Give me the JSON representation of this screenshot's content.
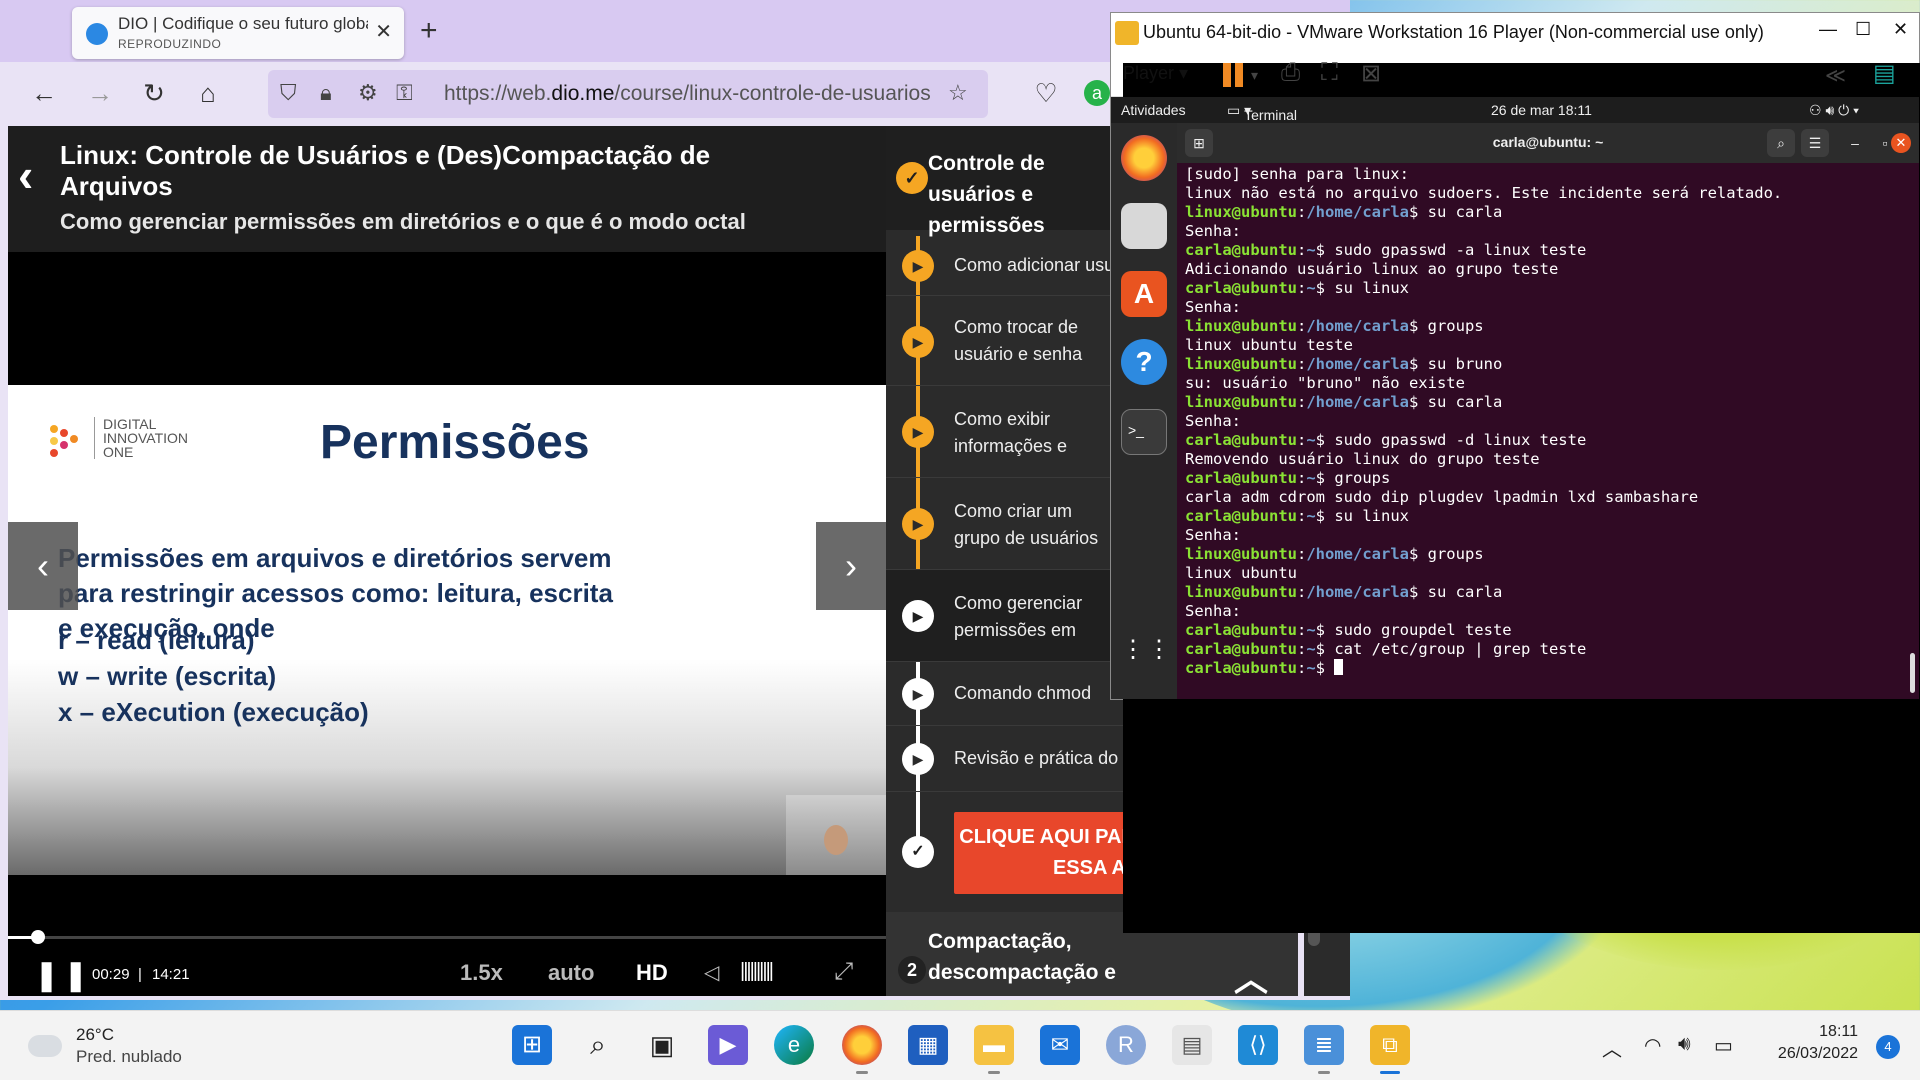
{
  "browser": {
    "tab_title": "DIO | Codifique o seu futuro global",
    "tab_status": "REPRODUZINDO",
    "url_prefix": "https://web.",
    "url_domain": "dio.me",
    "url_path": "/course/linux-controle-de-usuarios"
  },
  "course": {
    "title": "Linux: Controle de Usuários e (Des)Compactação de Arquivos",
    "subtitle": "Como gerenciar permissões em diretórios e o que é o modo octal"
  },
  "slide": {
    "logo_lines": [
      "DIGITAL",
      "INNOVATION",
      "ONE"
    ],
    "heading": "Permissões",
    "paragraph": "Permissões em arquivos e diretórios servem para restringir acessos como: leitura, escrita e execução, onde",
    "items": [
      "r – read (leitura)",
      "w – write (escrita)",
      "x – eXecution (execução)"
    ]
  },
  "player": {
    "current_time": "00:29",
    "separator": "|",
    "duration": "14:21",
    "speed": "1.5x",
    "quality_mode": "auto",
    "hd": "HD",
    "progress_fraction": 0.034
  },
  "lessons": {
    "section_title": "Controle de usuários e permissões",
    "items": [
      {
        "label": "Como adicionar usuários",
        "state": "current"
      },
      {
        "label": "Como trocar de usuário e senha",
        "state": "current"
      },
      {
        "label": "Como exibir informações e remover um usuário",
        "state": "current"
      },
      {
        "label": "Como criar um grupo de usuários",
        "state": "current"
      },
      {
        "label": "Como gerenciar permissões em diretórios e o que é o modo octal",
        "state": "playing"
      },
      {
        "label": "Comando chmod",
        "state": "pending"
      },
      {
        "label": "Revisão e prática do conteúdo",
        "state": "pending"
      }
    ],
    "cta": "CLIQUE AQUI PARA CONCLUIR ESSA AULA",
    "next_section_number": "2",
    "next_section_title": "Compactação, descompactação e"
  },
  "vmware": {
    "title": "Ubuntu 64-bit-dio - VMware Workstation 16 Player (Non-commercial use only)",
    "player_menu": "Player"
  },
  "gnome": {
    "activities": "Atividades",
    "app_menu": "Terminal",
    "clock": "26 de mar  18:11"
  },
  "terminal": {
    "title": "carla@ubuntu: ~",
    "lines": [
      {
        "t": "[sudo] senha para linux:"
      },
      {
        "t": "linux não está no arquivo sudoers. Este incidente será relatado."
      },
      {
        "user": "linux@ubuntu",
        "path": "/home/carla",
        "cmd": "su carla"
      },
      {
        "t": "Senha:"
      },
      {
        "user": "carla@ubuntu",
        "path": "~",
        "cmd": "sudo gpasswd -a linux teste"
      },
      {
        "t": "Adicionando usuário linux ao grupo teste"
      },
      {
        "user": "carla@ubuntu",
        "path": "~",
        "cmd": "su linux"
      },
      {
        "t": "Senha:"
      },
      {
        "user": "linux@ubuntu",
        "path": "/home/carla",
        "cmd": "groups"
      },
      {
        "t": "linux ubuntu teste"
      },
      {
        "user": "linux@ubuntu",
        "path": "/home/carla",
        "cmd": "su bruno"
      },
      {
        "t": "su: usuário \"bruno\" não existe"
      },
      {
        "user": "linux@ubuntu",
        "path": "/home/carla",
        "cmd": "su carla"
      },
      {
        "t": "Senha:"
      },
      {
        "user": "carla@ubuntu",
        "path": "~",
        "cmd": "sudo gpasswd -d linux teste"
      },
      {
        "t": "Removendo usuário linux do grupo teste"
      },
      {
        "user": "carla@ubuntu",
        "path": "~",
        "cmd": "groups"
      },
      {
        "t": "carla adm cdrom sudo dip plugdev lpadmin lxd sambashare"
      },
      {
        "user": "carla@ubuntu",
        "path": "~",
        "cmd": "su linux"
      },
      {
        "t": "Senha:"
      },
      {
        "user": "linux@ubuntu",
        "path": "/home/carla",
        "cmd": "groups"
      },
      {
        "t": "linux ubuntu"
      },
      {
        "user": "linux@ubuntu",
        "path": "/home/carla",
        "cmd": "su carla"
      },
      {
        "t": "Senha:"
      },
      {
        "user": "carla@ubuntu",
        "path": "~",
        "cmd": "sudo groupdel teste"
      },
      {
        "user": "carla@ubuntu",
        "path": "~",
        "cmd": "cat /etc/group | grep teste"
      },
      {
        "user": "carla@ubuntu",
        "path": "~",
        "cmd": "",
        "cursor": true
      }
    ]
  },
  "taskbar": {
    "temperature": "26°C",
    "weather": "Pred. nublado",
    "time": "18:11",
    "date": "26/03/2022",
    "notifications": "4"
  },
  "colors": {
    "accent_orange": "#f5a623",
    "cta_red": "#e8472b",
    "terminal_bg": "#300a24",
    "prompt_green": "#8ae234",
    "prompt_blue": "#729fcf",
    "slide_navy": "#17325d"
  }
}
